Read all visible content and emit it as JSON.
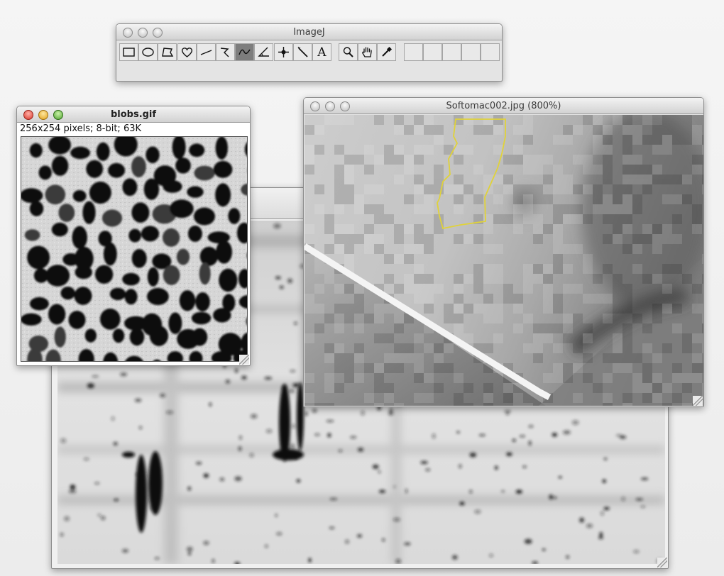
{
  "imagej_window": {
    "title": "ImageJ",
    "tools": [
      {
        "name": "rectangle-tool",
        "icon": "rectangle-icon"
      },
      {
        "name": "oval-tool",
        "icon": "oval-icon"
      },
      {
        "name": "polygon-tool",
        "icon": "polygon-icon"
      },
      {
        "name": "freehand-tool",
        "icon": "freehand-icon"
      },
      {
        "name": "straight-line-tool",
        "icon": "line-icon"
      },
      {
        "name": "segmented-line-tool",
        "icon": "segmented-line-icon"
      },
      {
        "name": "freehand-line-tool",
        "icon": "freehand-line-icon",
        "selected": true
      },
      {
        "name": "angle-tool",
        "icon": "angle-icon"
      },
      {
        "name": "point-tool",
        "icon": "crosshair-icon"
      },
      {
        "name": "wand-tool",
        "icon": "wand-icon"
      },
      {
        "name": "text-tool",
        "icon": "text-icon",
        "glyph": "A"
      },
      {
        "name": "magnifying-glass-tool",
        "icon": "magnifier-icon"
      },
      {
        "name": "scrolling-tool",
        "icon": "hand-icon"
      },
      {
        "name": "color-picker-tool",
        "icon": "eyedropper-icon"
      },
      {
        "name": "empty-slot-1",
        "icon": "blank-icon"
      },
      {
        "name": "empty-slot-2",
        "icon": "blank-icon"
      },
      {
        "name": "empty-slot-3",
        "icon": "blank-icon"
      },
      {
        "name": "empty-slot-4",
        "icon": "blank-icon"
      },
      {
        "name": "empty-slot-5",
        "icon": "blank-icon"
      }
    ]
  },
  "blobs_window": {
    "title": "blobs.gif",
    "info": "256x254 pixels; 8-bit; 63K"
  },
  "softomac_window": {
    "title": "Softomac002.jpg (800%)",
    "selection_color": "#e0d23a"
  },
  "gel_window": {
    "title": ""
  }
}
